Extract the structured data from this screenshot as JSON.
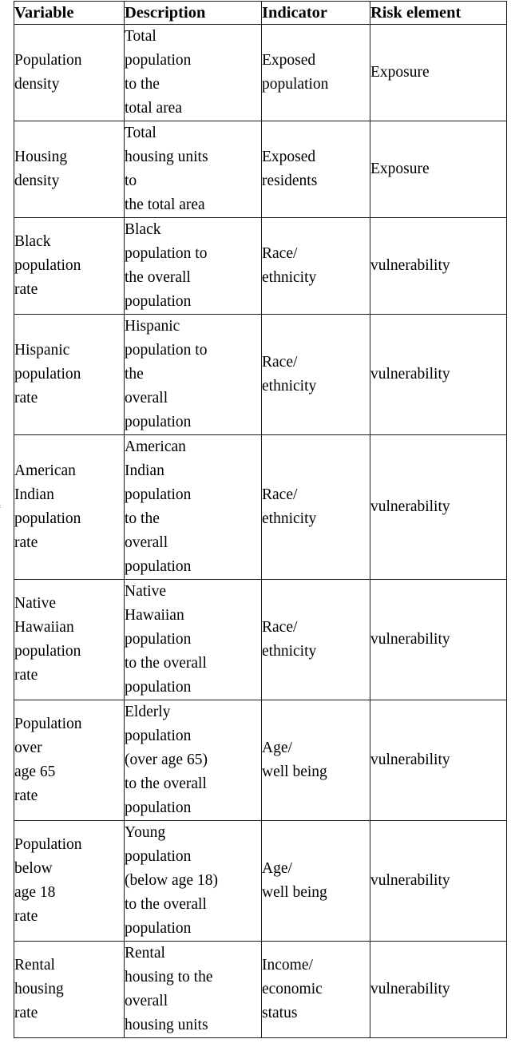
{
  "table": {
    "columns": [
      "Variable",
      "Description",
      "Indicator",
      "Risk element"
    ],
    "rows": [
      {
        "variable": [
          "Population",
          "density"
        ],
        "description": [
          "Total",
          "population",
          "to the",
          "total area"
        ],
        "indicator": [
          "Exposed",
          "population"
        ],
        "risk_element": [
          "Exposure"
        ]
      },
      {
        "variable": [
          "Housing",
          "density"
        ],
        "description": [
          "Total",
          "housing units",
          "to",
          "the total area"
        ],
        "indicator": [
          "Exposed",
          "residents"
        ],
        "risk_element": [
          "Exposure"
        ]
      },
      {
        "variable": [
          "Black",
          "population",
          "rate"
        ],
        "description": [
          "Black",
          "population to",
          "the overall",
          "population"
        ],
        "indicator": [
          "Race/",
          "ethnicity"
        ],
        "risk_element": [
          "vulnerability"
        ]
      },
      {
        "variable": [
          "Hispanic",
          "population",
          "rate"
        ],
        "description": [
          "Hispanic",
          "population to",
          "the",
          "overall",
          "population"
        ],
        "indicator": [
          "Race/",
          "ethnicity"
        ],
        "risk_element": [
          "vulnerability"
        ]
      },
      {
        "variable": [
          "American",
          "Indian",
          "population",
          "rate"
        ],
        "description": [
          "American",
          "Indian",
          "population",
          "to the",
          "overall",
          "population"
        ],
        "indicator": [
          "Race/",
          "ethnicity"
        ],
        "risk_element": [
          "vulnerability"
        ]
      },
      {
        "variable": [
          "Native",
          "Hawaiian",
          "population",
          "rate"
        ],
        "description": [
          "Native",
          "Hawaiian",
          "population",
          "to the overall",
          "population"
        ],
        "indicator": [
          "Race/",
          "ethnicity"
        ],
        "risk_element": [
          "vulnerability"
        ]
      },
      {
        "variable": [
          "Population",
          "over",
          "age 65",
          "rate"
        ],
        "description": [
          "Elderly",
          "population",
          "(over age 65)",
          "to the overall",
          "population"
        ],
        "indicator": [
          "Age/",
          "well being"
        ],
        "risk_element": [
          "vulnerability"
        ]
      },
      {
        "variable": [
          "Population",
          "below",
          "age 18",
          "rate"
        ],
        "description": [
          "Young",
          "population",
          "(below age 18)",
          "to the overall",
          "population"
        ],
        "indicator": [
          "Age/",
          "well being"
        ],
        "risk_element": [
          "vulnerability"
        ]
      },
      {
        "variable": [
          "Rental",
          "housing",
          "rate"
        ],
        "description": [
          "Rental",
          "housing to the",
          "overall",
          "housing units"
        ],
        "indicator": [
          "Income/",
          "economic",
          "status"
        ],
        "risk_element": [
          "vulnerability"
        ]
      }
    ]
  },
  "margin_glyph": "ʻ"
}
